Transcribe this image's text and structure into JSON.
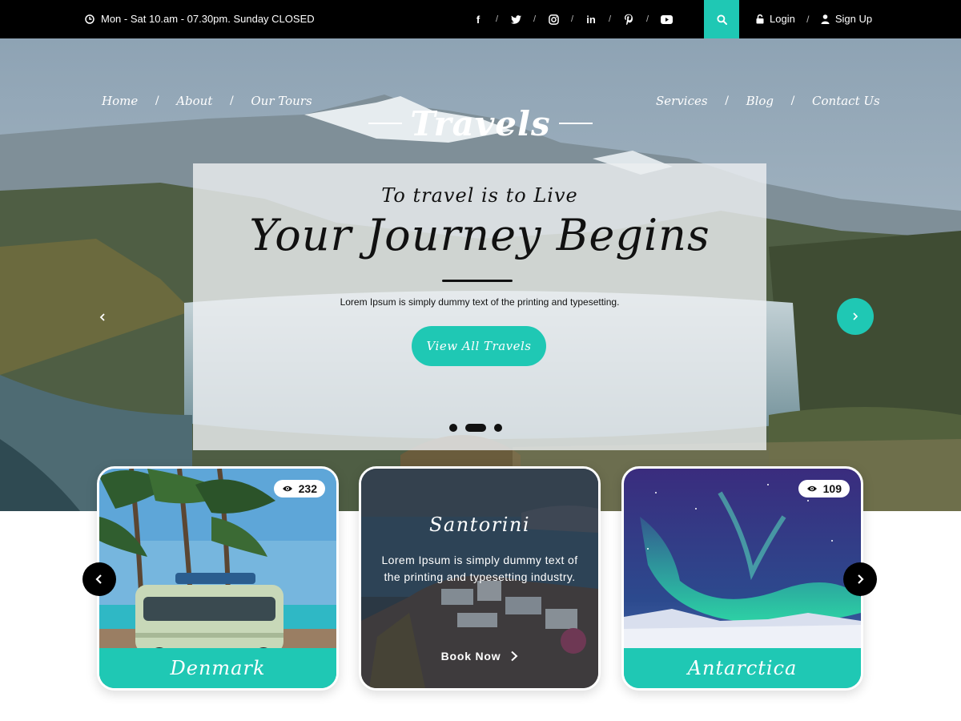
{
  "topbar": {
    "hours": "Mon - Sat 10.am - 07.30pm. Sunday CLOSED",
    "social_icons": [
      "facebook-icon",
      "twitter-icon",
      "instagram-icon",
      "linkedin-icon",
      "pinterest-icon",
      "youtube-icon"
    ],
    "social_glyphs": [
      "f",
      "",
      "",
      "in",
      "",
      ""
    ],
    "separator": "/",
    "login": "Login",
    "signup": "Sign Up"
  },
  "nav": {
    "left": [
      "Home",
      "About",
      "Our Tours"
    ],
    "right": [
      "Services",
      "Blog",
      "Contact Us"
    ],
    "separator": "/",
    "logo": "Travels"
  },
  "hero": {
    "tagline": "To travel is to Live",
    "headline": "Your Journey Begins",
    "description": "Lorem Ipsum is simply dummy text of the printing and typesetting.",
    "cta": "View All Travels",
    "slides": 3,
    "active_slide": 2
  },
  "cards": {
    "left": {
      "name": "Denmark",
      "views": "232"
    },
    "middle": {
      "title": "Santorini",
      "text": "Lorem Ipsum is simply dummy text of the printing and typesetting industry.",
      "cta": "Book Now"
    },
    "right": {
      "name": "Antarctica",
      "views": "109"
    }
  },
  "colors": {
    "accent": "#1fc8b4",
    "topbar": "#000000",
    "text_dark": "#111111"
  }
}
